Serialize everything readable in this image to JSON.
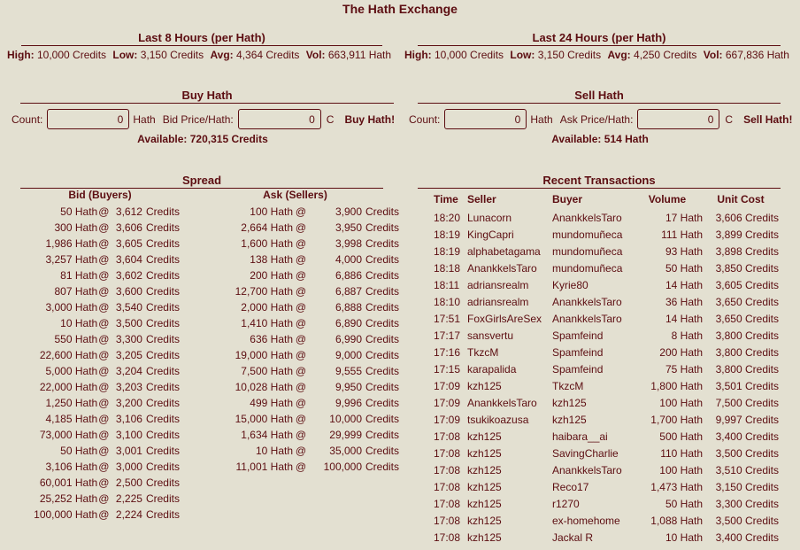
{
  "title": "The Hath Exchange",
  "last8": {
    "heading": "Last 8 Hours (per Hath)",
    "high_label": "High:",
    "high": "10,000 Credits",
    "low_label": "Low:",
    "low": "3,150 Credits",
    "avg_label": "Avg:",
    "avg": "4,364 Credits",
    "vol_label": "Vol:",
    "vol": "663,911 Hath"
  },
  "last24": {
    "heading": "Last 24 Hours (per Hath)",
    "high_label": "High:",
    "high": "10,000 Credits",
    "low_label": "Low:",
    "low": "3,150 Credits",
    "avg_label": "Avg:",
    "avg": "4,250 Credits",
    "vol_label": "Vol:",
    "vol": "667,836 Hath"
  },
  "buy": {
    "heading": "Buy Hath",
    "count_label": "Count:",
    "count_value": "0",
    "count_unit": "Hath",
    "price_label": "Bid Price/Hath:",
    "price_value": "0",
    "price_unit": "C",
    "button": "Buy Hath!",
    "available": "Available: 720,315 Credits"
  },
  "sell": {
    "heading": "Sell Hath",
    "count_label": "Count:",
    "count_value": "0",
    "count_unit": "Hath",
    "price_label": "Ask Price/Hath:",
    "price_value": "0",
    "price_unit": "C",
    "button": "Sell Hath!",
    "available": "Available: 514 Hath"
  },
  "spread": {
    "heading": "Spread",
    "bid_heading": "Bid (Buyers)",
    "ask_heading": "Ask (Sellers)",
    "bids": [
      [
        "50 Hath",
        "3,612"
      ],
      [
        "300 Hath",
        "3,606"
      ],
      [
        "1,986 Hath",
        "3,605"
      ],
      [
        "3,257 Hath",
        "3,604"
      ],
      [
        "81 Hath",
        "3,602"
      ],
      [
        "807 Hath",
        "3,600"
      ],
      [
        "3,000 Hath",
        "3,540"
      ],
      [
        "10 Hath",
        "3,500"
      ],
      [
        "550 Hath",
        "3,300"
      ],
      [
        "22,600 Hath",
        "3,205"
      ],
      [
        "5,000 Hath",
        "3,204"
      ],
      [
        "22,000 Hath",
        "3,203"
      ],
      [
        "1,250 Hath",
        "3,200"
      ],
      [
        "4,185 Hath",
        "3,106"
      ],
      [
        "73,000 Hath",
        "3,100"
      ],
      [
        "50 Hath",
        "3,001"
      ],
      [
        "3,106 Hath",
        "3,000"
      ],
      [
        "60,001 Hath",
        "2,500"
      ],
      [
        "25,252 Hath",
        "2,225"
      ],
      [
        "100,000 Hath",
        "2,224"
      ]
    ],
    "asks": [
      [
        "100 Hath",
        "3,900"
      ],
      [
        "2,664 Hath",
        "3,950"
      ],
      [
        "1,600 Hath",
        "3,998"
      ],
      [
        "138 Hath",
        "4,000"
      ],
      [
        "200 Hath",
        "6,886"
      ],
      [
        "12,700 Hath",
        "6,887"
      ],
      [
        "2,000 Hath",
        "6,888"
      ],
      [
        "1,410 Hath",
        "6,890"
      ],
      [
        "636 Hath",
        "6,990"
      ],
      [
        "19,000 Hath",
        "9,000"
      ],
      [
        "7,500 Hath",
        "9,555"
      ],
      [
        "10,028 Hath",
        "9,950"
      ],
      [
        "499 Hath",
        "9,996"
      ],
      [
        "15,000 Hath",
        "10,000"
      ],
      [
        "1,634 Hath",
        "29,999"
      ],
      [
        "10 Hath",
        "35,000"
      ],
      [
        "11,001 Hath",
        "100,000"
      ]
    ],
    "at": "@",
    "credits_word": "Credits"
  },
  "recent": {
    "heading": "Recent Transactions",
    "columns": [
      "Time",
      "Seller",
      "Buyer",
      "Volume",
      "Unit Cost"
    ],
    "rows": [
      [
        "18:20",
        "Lunacorn",
        "AnankkelsTaro",
        "17 Hath",
        "3,606 Credits"
      ],
      [
        "18:19",
        "KingCapri",
        "mundomuñeca",
        "111 Hath",
        "3,899 Credits"
      ],
      [
        "18:19",
        "alphabetagama",
        "mundomuñeca",
        "93 Hath",
        "3,898 Credits"
      ],
      [
        "18:18",
        "AnankkelsTaro",
        "mundomuñeca",
        "50 Hath",
        "3,850 Credits"
      ],
      [
        "18:11",
        "adriansrealm",
        "Kyrie80",
        "14 Hath",
        "3,605 Credits"
      ],
      [
        "18:10",
        "adriansrealm",
        "AnankkelsTaro",
        "36 Hath",
        "3,650 Credits"
      ],
      [
        "17:51",
        "FoxGirlsAreSex",
        "AnankkelsTaro",
        "14 Hath",
        "3,650 Credits"
      ],
      [
        "17:17",
        "sansvertu",
        "Spamfeind",
        "8 Hath",
        "3,800 Credits"
      ],
      [
        "17:16",
        "TkzcM",
        "Spamfeind",
        "200 Hath",
        "3,800 Credits"
      ],
      [
        "17:15",
        "karapalida",
        "Spamfeind",
        "75 Hath",
        "3,800 Credits"
      ],
      [
        "17:09",
        "kzh125",
        "TkzcM",
        "1,800 Hath",
        "3,501 Credits"
      ],
      [
        "17:09",
        "AnankkelsTaro",
        "kzh125",
        "100 Hath",
        "7,500 Credits"
      ],
      [
        "17:09",
        "tsukikoazusa",
        "kzh125",
        "1,700 Hath",
        "9,997 Credits"
      ],
      [
        "17:08",
        "kzh125",
        "haibara__ai",
        "500 Hath",
        "3,400 Credits"
      ],
      [
        "17:08",
        "kzh125",
        "SavingCharlie",
        "110 Hath",
        "3,500 Credits"
      ],
      [
        "17:08",
        "kzh125",
        "AnankkelsTaro",
        "100 Hath",
        "3,510 Credits"
      ],
      [
        "17:08",
        "kzh125",
        "Reco17",
        "1,473 Hath",
        "3,150 Credits"
      ],
      [
        "17:08",
        "kzh125",
        "r1270",
        "50 Hath",
        "3,300 Credits"
      ],
      [
        "17:08",
        "kzh125",
        "ex-homehome",
        "1,088 Hath",
        "3,500 Credits"
      ],
      [
        "17:08",
        "kzh125",
        "Jackal R",
        "10 Hath",
        "3,400 Credits"
      ]
    ]
  }
}
